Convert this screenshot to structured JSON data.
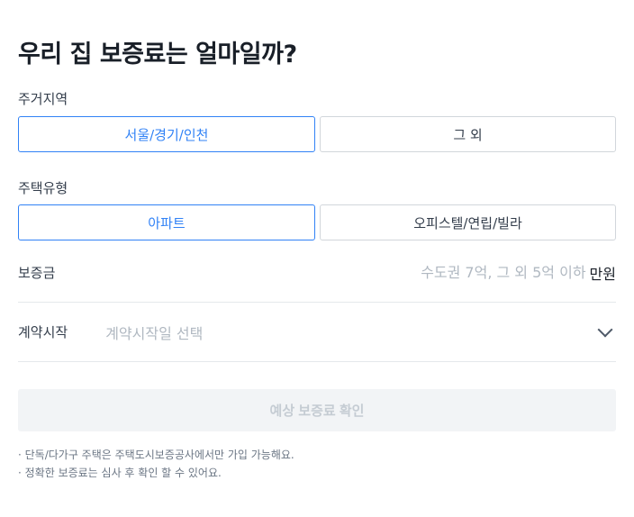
{
  "title": "우리 집 보증료는 얼마일까?",
  "region": {
    "label": "주거지역",
    "options": [
      "서울/경기/인천",
      "그 외"
    ],
    "selected": "서울/경기/인천"
  },
  "house_type": {
    "label": "주택유형",
    "options": [
      "아파트",
      "오피스텔/연립/빌라"
    ],
    "selected": "아파트"
  },
  "deposit": {
    "label": "보증금",
    "placeholder": "수도권 7억, 그 외 5억 이하",
    "value": "",
    "unit": "만원"
  },
  "contract_start": {
    "label": "계약시작",
    "placeholder": "계약시작일 선택",
    "icon": "chevron-down-icon"
  },
  "submit": {
    "label": "예상 보증료 확인",
    "enabled": false
  },
  "notes": [
    "· 단독/다가구 주택은 주택도시보증공사에서만 가입 가능해요.",
    "· 정확한 보증료는 심사 후 확인 할 수 있어요."
  ],
  "colors": {
    "accent": "#3182f6",
    "text": "#191f28",
    "placeholder": "#b0b8c1",
    "border": "#d1d6db",
    "disabled_bg": "#f2f4f6"
  }
}
